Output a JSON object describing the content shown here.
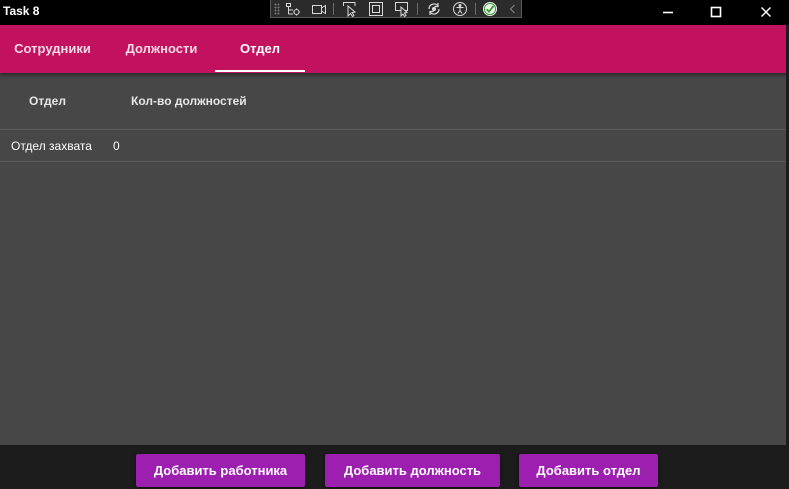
{
  "window": {
    "title": "Task 8"
  },
  "titlebar_buttons": {
    "minimize": "minimize-icon",
    "maximize": "maximize-icon",
    "close": "close-icon"
  },
  "debug_toolbar": {
    "icons": [
      "live-visual-tree-icon",
      "record-icon",
      "select-element-icon",
      "display-layout-adorners-icon",
      "track-focused-element-icon",
      "hot-reload-icon",
      "accessibility-icon",
      "hot-reload-ok-icon",
      "collapse-icon"
    ]
  },
  "tabs": [
    {
      "label": "Сотрудники",
      "selected": false
    },
    {
      "label": "Должности",
      "selected": false
    },
    {
      "label": "Отдел",
      "selected": true
    }
  ],
  "grid": {
    "columns": [
      "Отдел",
      "Кол-во должностей"
    ],
    "rows": [
      [
        "Отдел захвата",
        "0"
      ]
    ]
  },
  "buttons": {
    "add_employee": "Добавить работника",
    "add_position": "Добавить должность",
    "add_department": "Добавить отдел"
  },
  "colors": {
    "accent": "#c2125f",
    "button": "#9c1fb0",
    "background": "#474747",
    "titlebar": "#000000",
    "bottombar": "#1c1c1c"
  }
}
